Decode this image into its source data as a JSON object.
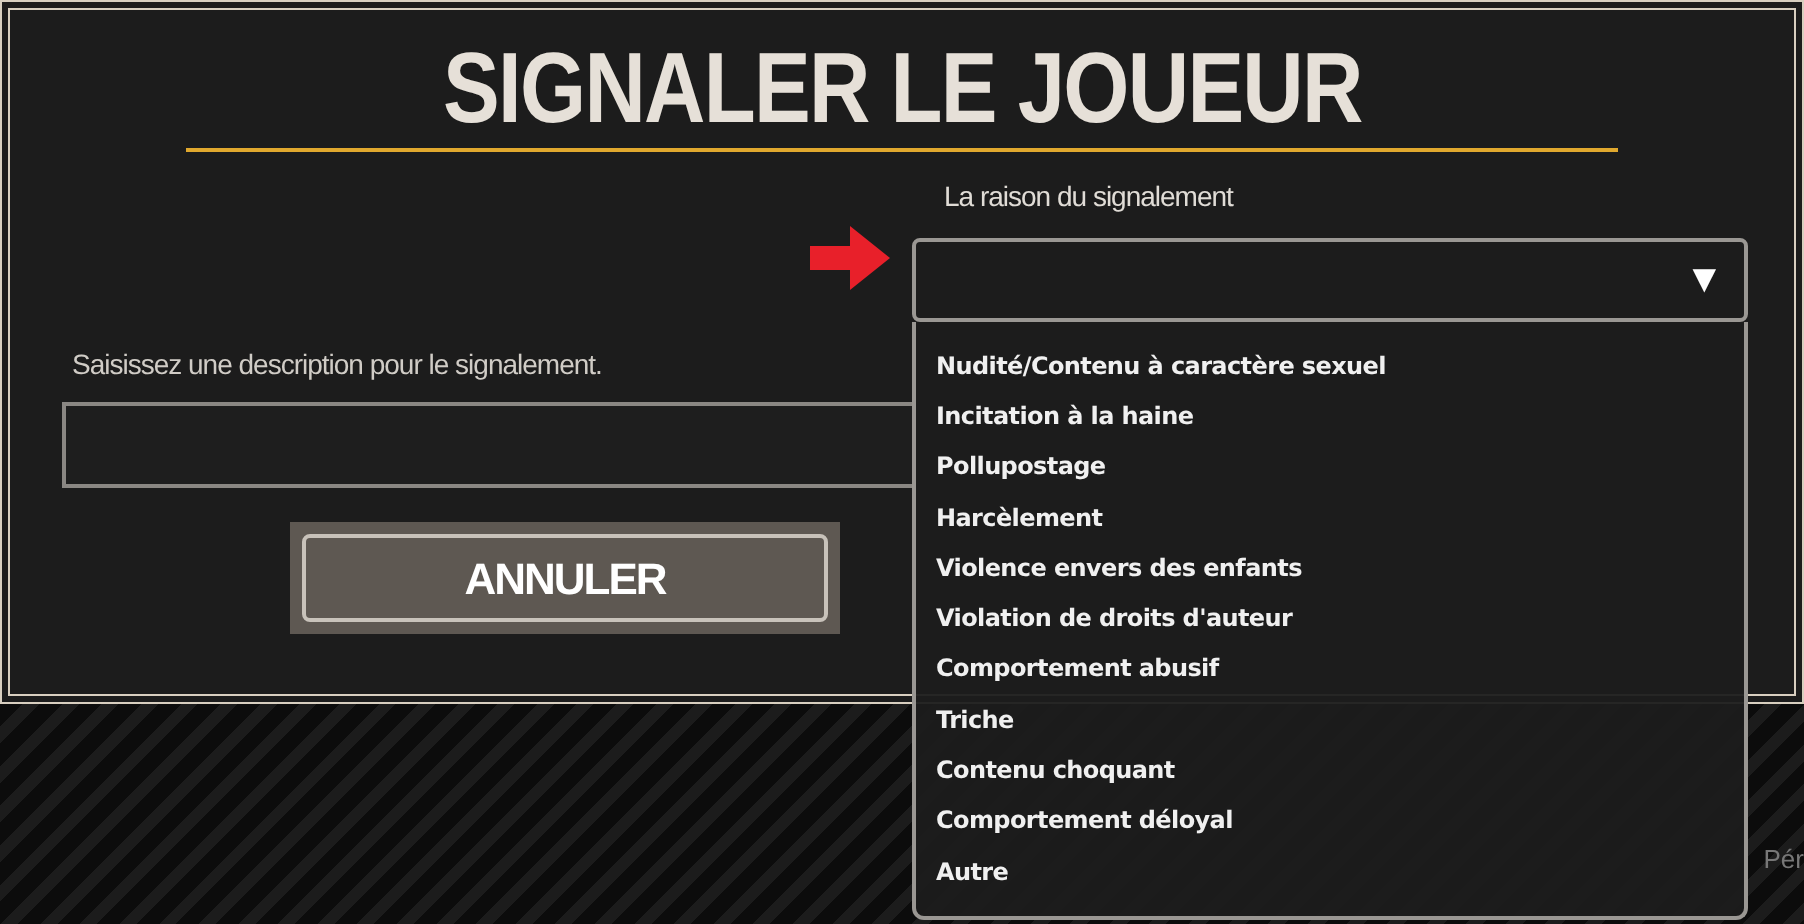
{
  "dialog": {
    "title": "SIGNALER LE JOUEUR",
    "reason_select": {
      "label": "La raison du signalement",
      "toggle": "▼",
      "expanded": true,
      "options": [
        "Nudité/Contenu à caractère sexuel",
        "Incitation à la haine",
        "Pollupostage",
        "Harcèlement",
        "Violence envers des enfants",
        "Violation de droits d'auteur",
        "Comportement abusif",
        "Triche",
        "Contenu choquant",
        "Comportement déloyal",
        "Autre"
      ]
    },
    "description_field": {
      "label": "Saisissez une description pour le signalement."
    },
    "cancel_button": "ANNULER"
  },
  "background": {
    "text_fragment": "Pér"
  }
}
